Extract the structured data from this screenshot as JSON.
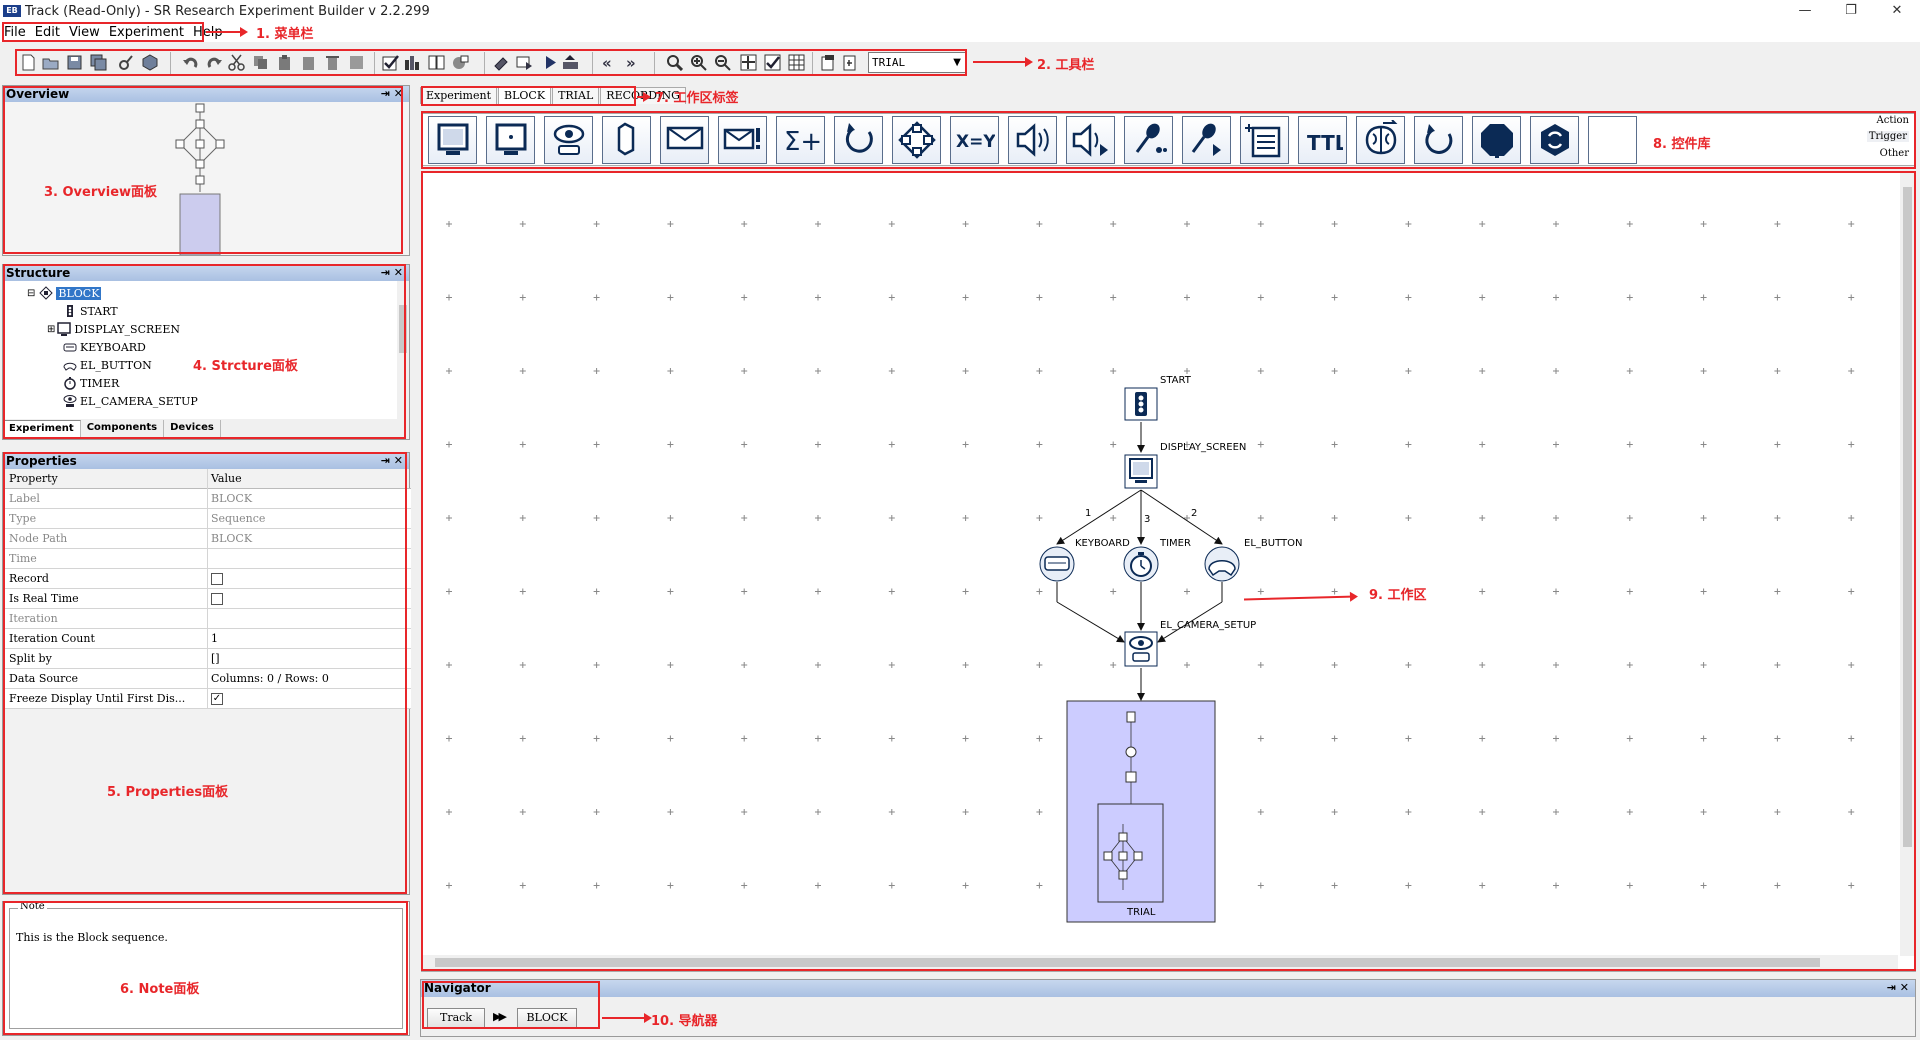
{
  "window": {
    "title": "Track (Read-Only) - SR Research Experiment Builder v 2.2.299",
    "app_icon": "EB",
    "minimize": "—",
    "restore": "❐",
    "close": "✕"
  },
  "menu": {
    "items": [
      "File",
      "Edit",
      "View",
      "Experiment",
      "Help"
    ]
  },
  "toolbar": {
    "trial_select": "TRIAL"
  },
  "annotations": {
    "menubar": "1. 菜单栏",
    "toolbar": "2. 工具栏",
    "overview": "3. Overview面板",
    "structure": "4. Strcture面板",
    "properties": "5. Properties面板",
    "note": "6. Note面板",
    "tabs": "7. 工作区标签",
    "library": "8. 控件库",
    "workspace": "9. 工作区",
    "navigator": "10. 导航器",
    "color": "#e8262a"
  },
  "overview": {
    "title": "Overview"
  },
  "structure": {
    "title": "Structure",
    "items": [
      {
        "label": "BLOCK",
        "icon": "block-icon"
      },
      {
        "label": "START",
        "icon": "start-icon"
      },
      {
        "label": "DISPLAY_SCREEN",
        "icon": "display-screen-icon"
      },
      {
        "label": "KEYBOARD",
        "icon": "keyboard-icon"
      },
      {
        "label": "EL_BUTTON",
        "icon": "el-button-icon"
      },
      {
        "label": "TIMER",
        "icon": "timer-icon"
      },
      {
        "label": "EL_CAMERA_SETUP",
        "icon": "camera-setup-icon"
      }
    ],
    "tabs": [
      "Experiment",
      "Components",
      "Devices"
    ]
  },
  "properties": {
    "title": "Properties",
    "header_property": "Property",
    "header_value": "Value",
    "rows": [
      {
        "key": "Label",
        "value": "BLOCK",
        "type": "text",
        "grey": true
      },
      {
        "key": "Type",
        "value": "Sequence",
        "type": "text",
        "grey": true
      },
      {
        "key": "Node Path",
        "value": "BLOCK",
        "type": "text",
        "grey": true
      },
      {
        "key": "Time",
        "value": "",
        "type": "text",
        "grey": true
      },
      {
        "key": "Record",
        "value": "",
        "type": "checkbox",
        "checked": false
      },
      {
        "key": "Is Real Time",
        "value": "",
        "type": "checkbox",
        "checked": false
      },
      {
        "key": "Iteration",
        "value": "",
        "type": "text",
        "grey": true
      },
      {
        "key": "Iteration Count",
        "value": "1",
        "type": "text"
      },
      {
        "key": "Split by",
        "value": "[]",
        "type": "text"
      },
      {
        "key": "Data Source",
        "value": "Columns: 0 / Rows: 0",
        "type": "text"
      },
      {
        "key": "Freeze Display Until First Dis...",
        "value": "",
        "type": "checkbox",
        "checked": true
      }
    ]
  },
  "note": {
    "title": "Note",
    "text": "This is the Block sequence."
  },
  "workspace_tabs": [
    "Experiment",
    "BLOCK",
    "TRIAL",
    "RECORDING"
  ],
  "library": {
    "categories": [
      "Action",
      "Trigger",
      "Other"
    ],
    "buttons": [
      "display-screen-icon",
      "drift-correct-icon",
      "eye-camera-setup-icon",
      "send-el-message-icon",
      "send-message-icon",
      "send-error-icon",
      "add-accumulator-icon",
      "loop-icon",
      "sequence-node-icon",
      "update-attribute-icon",
      "play-sound-icon",
      "play-sound-control-icon",
      "record-audio-icon",
      "record-audio-control-icon",
      "add-to-results-icon",
      "ttl-output-icon",
      "execute-brain-icon",
      "recycle-loop-icon",
      "terminate-icon",
      "recycle-data-icon",
      "empty-slot-icon"
    ]
  },
  "diagram": {
    "nodes": {
      "start": "START",
      "display": "DISPLAY_SCREEN",
      "keyboard": "KEYBOARD",
      "timer": "TIMER",
      "el_button": "EL_BUTTON",
      "camera": "EL_CAMERA_SETUP",
      "trial": "TRIAL"
    },
    "edges": {
      "keyboard": "1",
      "timer": "3",
      "el_button": "2"
    }
  },
  "navigator": {
    "title": "Navigator",
    "crumbs": [
      "Track",
      "BLOCK"
    ],
    "separator": "▶▶"
  }
}
